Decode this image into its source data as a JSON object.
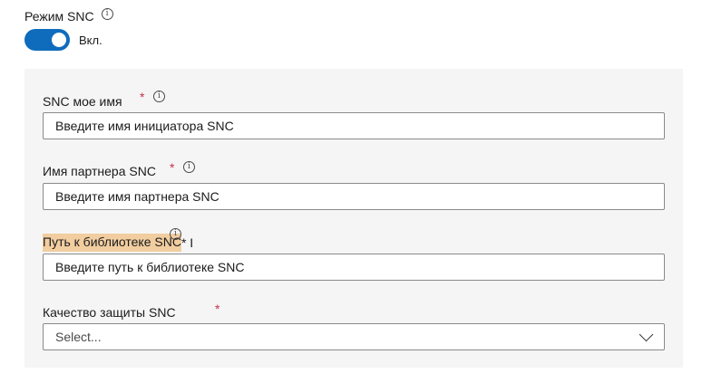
{
  "snc_mode": {
    "label": "Режим SNC",
    "toggle_state": "Вкл.",
    "enabled": true
  },
  "fields": {
    "my_name": {
      "label": "SNC мое имя",
      "required_mark": "*",
      "placeholder": "Введите имя инициатора SNC"
    },
    "partner_name": {
      "label": "Имя партнера SNC",
      "required_mark": "*",
      "placeholder": "Введите имя партнера SNC"
    },
    "library_path": {
      "label_highlighted": "Путь к библиотеке SNC",
      "label_suffix": "* I",
      "placeholder": "Введите путь к библиотеке SNC"
    },
    "protection_quality": {
      "label": "Качество защиты SNC",
      "required_mark": "*",
      "selected": "Select..."
    }
  },
  "colors": {
    "accent": "#0f6cbd",
    "required": "#c4314b",
    "highlight": "#f1cda0",
    "panel_bg": "#f5f5f5"
  },
  "icons": {
    "info": "info-circle-icon",
    "dropdown": "chevron-down-icon"
  }
}
